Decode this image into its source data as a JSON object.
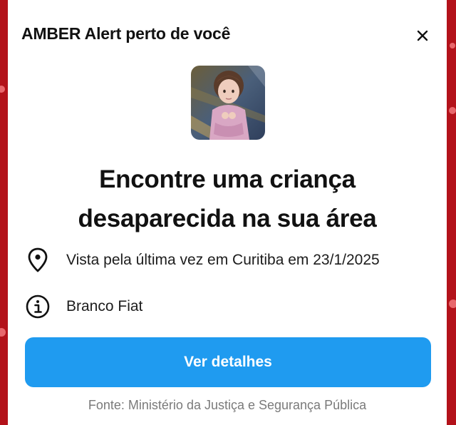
{
  "alert": {
    "title": "AMBER Alert perto de você",
    "headline_line1": "Encontre uma criança",
    "headline_line2": "desaparecida na sua área",
    "location_text": "Vista pela última vez em Curitiba em 23/1/2025",
    "vehicle_text": "Branco Fiat",
    "button_label": "Ver detalhes",
    "source_text": "Fonte: Ministério da Justiça e Segurança Pública"
  },
  "icons": {
    "close": "close-icon",
    "location": "location-pin-icon",
    "info": "info-icon"
  },
  "colors": {
    "background": "#b3121a",
    "button": "#1f9bf0",
    "button_text": "#ffffff",
    "card": "#ffffff"
  }
}
